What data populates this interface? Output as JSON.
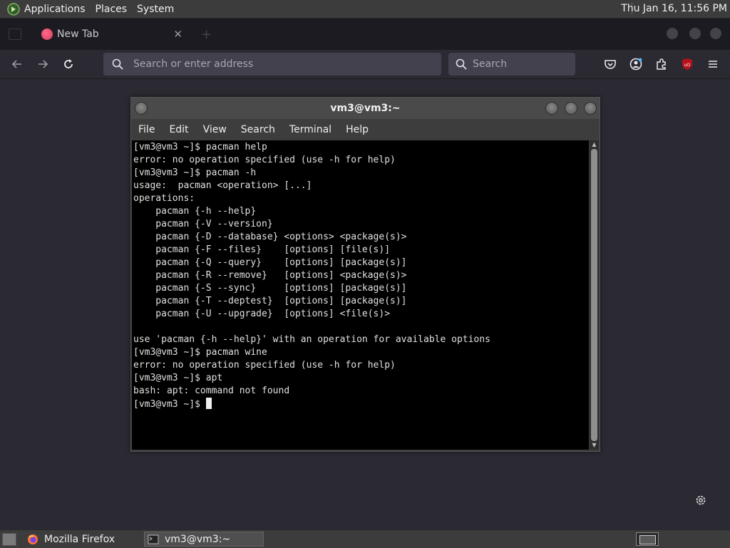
{
  "top_panel": {
    "menus": [
      "Applications",
      "Places",
      "System"
    ],
    "clock": "Thu Jan 16, 11:56 PM"
  },
  "browser": {
    "tab_label": "New Tab",
    "tab_close": "✕",
    "url_placeholder": "Search or enter address",
    "search_placeholder": "Search"
  },
  "terminal": {
    "title": "vm3@vm3:~",
    "menus": [
      "File",
      "Edit",
      "View",
      "Search",
      "Terminal",
      "Help"
    ],
    "lines": [
      "[vm3@vm3 ~]$ pacman help",
      "error: no operation specified (use -h for help)",
      "[vm3@vm3 ~]$ pacman -h",
      "usage:  pacman <operation> [...]",
      "operations:",
      "    pacman {-h --help}",
      "    pacman {-V --version}",
      "    pacman {-D --database} <options> <package(s)>",
      "    pacman {-F --files}    [options] [file(s)]",
      "    pacman {-Q --query}    [options] [package(s)]",
      "    pacman {-R --remove}   [options] <package(s)>",
      "    pacman {-S --sync}     [options] [package(s)]",
      "    pacman {-T --deptest}  [options] [package(s)]",
      "    pacman {-U --upgrade}  [options] <file(s)>",
      "",
      "use 'pacman {-h --help}' with an operation for available options",
      "[vm3@vm3 ~]$ pacman wine",
      "error: no operation specified (use -h for help)",
      "[vm3@vm3 ~]$ apt",
      "bash: apt: command not found"
    ],
    "prompt": "[vm3@vm3 ~]$ "
  },
  "taskbar": {
    "items": [
      "Mozilla Firefox",
      "vm3@vm3:~"
    ]
  },
  "icons": {
    "panel_logo": "mate-logo-icon",
    "ublock": "ublock-origin-icon"
  },
  "colors": {
    "firefox_bg": "#2b2a33",
    "terminal_bg": "#000000",
    "ublock_red": "#b5121b"
  }
}
